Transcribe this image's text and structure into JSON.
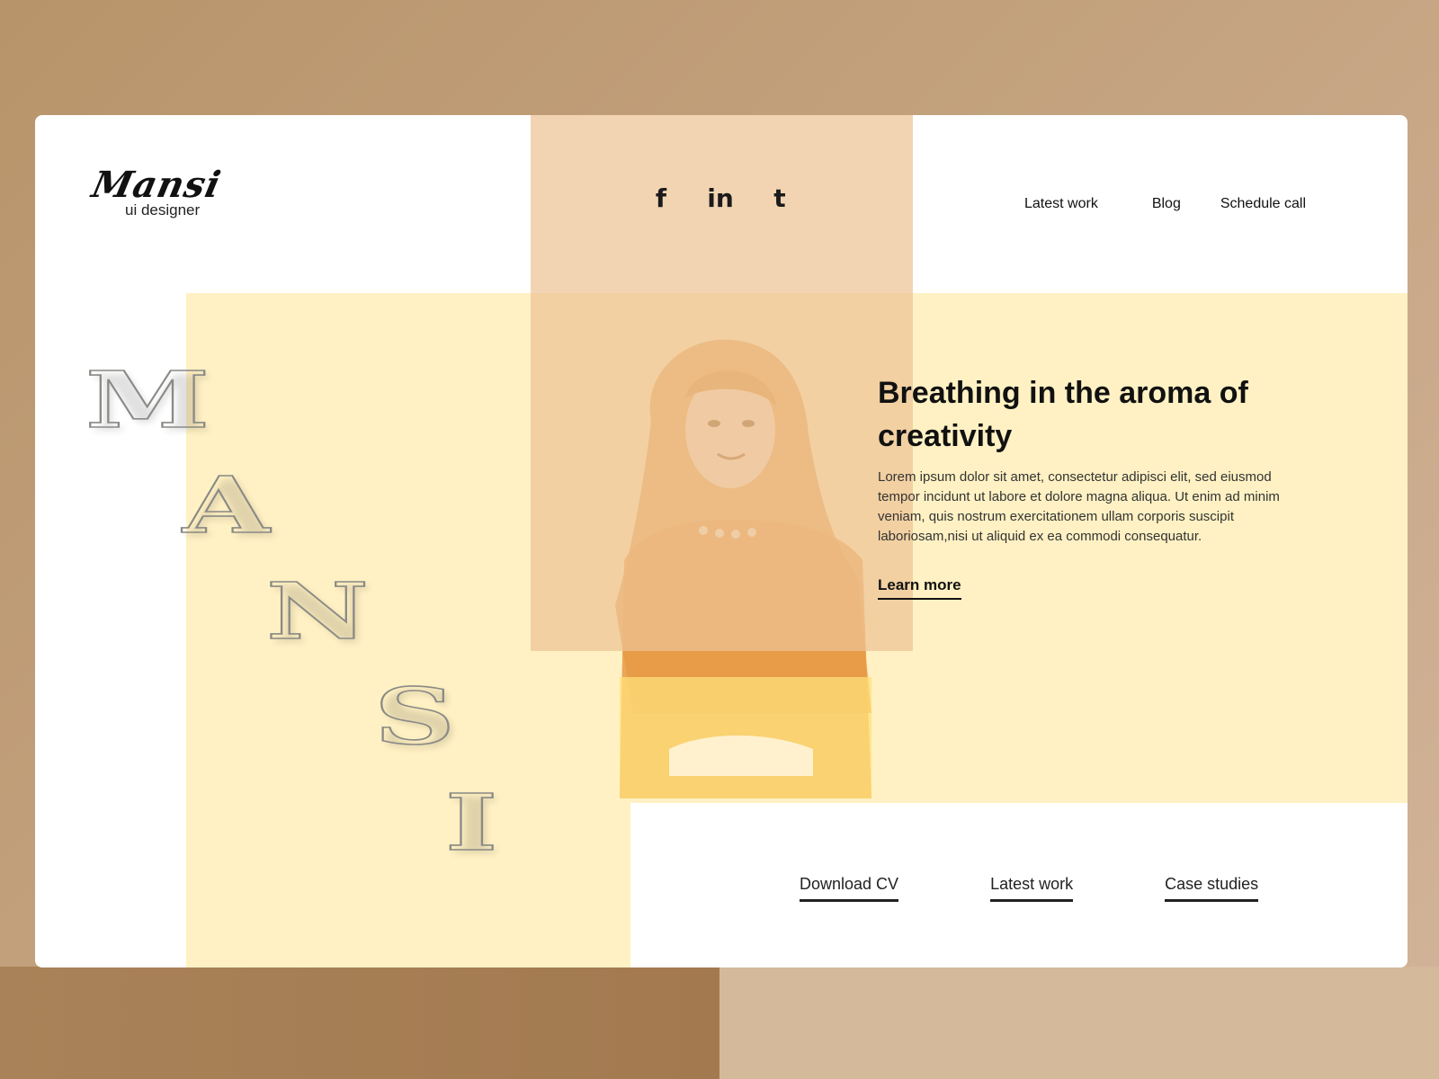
{
  "brand": {
    "name": "Mansi",
    "tagline": "ui designer"
  },
  "social": [
    {
      "name": "facebook",
      "glyph": "f"
    },
    {
      "name": "linkedin",
      "glyph": "in"
    },
    {
      "name": "tumblr",
      "glyph": "t"
    }
  ],
  "nav": {
    "latest_work": "Latest work",
    "blog": "Blog",
    "schedule_call": "Schedule call"
  },
  "vertical_name": [
    "M",
    "A",
    "N",
    "S",
    "I"
  ],
  "hero": {
    "title": "Breathing in the aroma of creativity",
    "body": "Lorem ipsum dolor sit amet, consectetur adipisci elit, sed eiusmod tempor incidunt ut labore et dolore magna aliqua. Ut enim ad minim veniam, quis nostrum exercitationem ullam corporis suscipit laboriosam,nisi ut aliquid ex ea commodi consequatur.",
    "learn_more": "Learn more"
  },
  "bottom_links": {
    "download_cv": "Download CV",
    "latest_work": "Latest work",
    "case_studies": "Case studies"
  },
  "colors": {
    "background": "#c1a07c",
    "accent_yellow": "#fff1c3",
    "accent_orange": "#edc496",
    "text": "#111111"
  }
}
